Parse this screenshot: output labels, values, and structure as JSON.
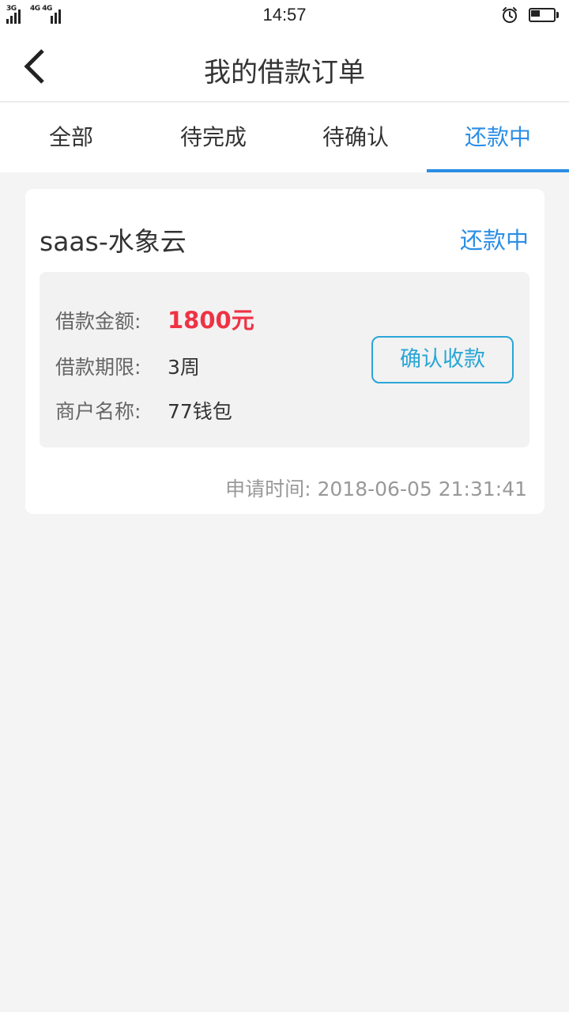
{
  "status_bar": {
    "time": "14:57",
    "signal_1_label": "3G",
    "signal_2_label": "4G 4G",
    "alarm_icon": "alarm-clock-icon",
    "battery_level": 0.4
  },
  "header": {
    "title": "我的借款订单",
    "back_icon": "chevron-left-icon"
  },
  "tabs": [
    {
      "label": "全部",
      "active": false
    },
    {
      "label": "待完成",
      "active": false
    },
    {
      "label": "待确认",
      "active": false
    },
    {
      "label": "还款中",
      "active": true
    }
  ],
  "colors": {
    "accent": "#2b8ee6",
    "button": "#29a6d6",
    "amount": "#ee3344",
    "background": "#f4f4f4"
  },
  "orders": [
    {
      "name": "saas-水象云",
      "status": "还款中",
      "amount_label": "借款金额:",
      "amount_value": "1800元",
      "term_label": "借款期限:",
      "term_value": "3周",
      "merchant_label": "商户名称:",
      "merchant_value": "77钱包",
      "confirm_button": "确认收款",
      "apply_time_label": "申请时间:",
      "apply_time_value": "2018-06-05 21:31:41"
    }
  ]
}
